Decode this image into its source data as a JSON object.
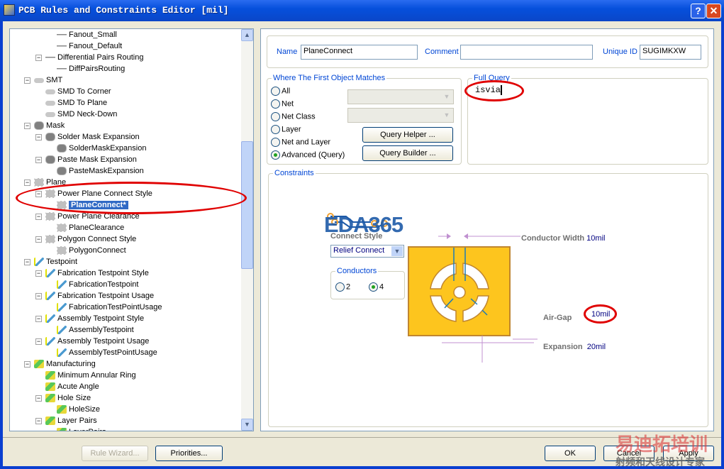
{
  "window": {
    "title": "PCB Rules and Constraints Editor [mil]",
    "help": "?",
    "close": "✕"
  },
  "tree": {
    "items": [
      {
        "label": "Fanout_Small",
        "level": 2,
        "icon": "route",
        "exp": false
      },
      {
        "label": "Fanout_Default",
        "level": 2,
        "icon": "route",
        "exp": false
      },
      {
        "label": "Differential Pairs Routing",
        "level": 1,
        "icon": "route",
        "exp": true
      },
      {
        "label": "DiffPairsRouting",
        "level": 2,
        "icon": "route",
        "exp": false
      },
      {
        "label": "SMT",
        "level": 0,
        "icon": "smt",
        "exp": true
      },
      {
        "label": "SMD To Corner",
        "level": 1,
        "icon": "smt",
        "exp": false
      },
      {
        "label": "SMD To Plane",
        "level": 1,
        "icon": "smt",
        "exp": false
      },
      {
        "label": "SMD Neck-Down",
        "level": 1,
        "icon": "smt",
        "exp": false
      },
      {
        "label": "Mask",
        "level": 0,
        "icon": "mask",
        "exp": true
      },
      {
        "label": "Solder Mask Expansion",
        "level": 1,
        "icon": "mask",
        "exp": true
      },
      {
        "label": "SolderMaskExpansion",
        "level": 2,
        "icon": "mask",
        "exp": false
      },
      {
        "label": "Paste Mask Expansion",
        "level": 1,
        "icon": "mask",
        "exp": true
      },
      {
        "label": "PasteMaskExpansion",
        "level": 2,
        "icon": "mask",
        "exp": false
      },
      {
        "label": "Plane",
        "level": 0,
        "icon": "plane",
        "exp": true
      },
      {
        "label": "Power Plane Connect Style",
        "level": 1,
        "icon": "plane",
        "exp": true
      },
      {
        "label": "PlaneConnect*",
        "level": 2,
        "icon": "plane",
        "exp": false,
        "selected": true
      },
      {
        "label": "Power Plane Clearance",
        "level": 1,
        "icon": "plane",
        "exp": true
      },
      {
        "label": "PlaneClearance",
        "level": 2,
        "icon": "plane",
        "exp": false
      },
      {
        "label": "Polygon Connect Style",
        "level": 1,
        "icon": "plane",
        "exp": true
      },
      {
        "label": "PolygonConnect",
        "level": 2,
        "icon": "plane",
        "exp": false
      },
      {
        "label": "Testpoint",
        "level": 0,
        "icon": "test",
        "exp": true
      },
      {
        "label": "Fabrication Testpoint Style",
        "level": 1,
        "icon": "test",
        "exp": true
      },
      {
        "label": "FabricationTestpoint",
        "level": 2,
        "icon": "test",
        "exp": false
      },
      {
        "label": "Fabrication Testpoint Usage",
        "level": 1,
        "icon": "test",
        "exp": true
      },
      {
        "label": "FabricationTestPointUsage",
        "level": 2,
        "icon": "test",
        "exp": false
      },
      {
        "label": "Assembly Testpoint Style",
        "level": 1,
        "icon": "test",
        "exp": true
      },
      {
        "label": "AssemblyTestpoint",
        "level": 2,
        "icon": "test",
        "exp": false
      },
      {
        "label": "Assembly Testpoint Usage",
        "level": 1,
        "icon": "test",
        "exp": true
      },
      {
        "label": "AssemblyTestPointUsage",
        "level": 2,
        "icon": "test",
        "exp": false
      },
      {
        "label": "Manufacturing",
        "level": 0,
        "icon": "mfg",
        "exp": true
      },
      {
        "label": "Minimum Annular Ring",
        "level": 1,
        "icon": "mfg",
        "exp": false
      },
      {
        "label": "Acute Angle",
        "level": 1,
        "icon": "mfg",
        "exp": false
      },
      {
        "label": "Hole Size",
        "level": 1,
        "icon": "mfg",
        "exp": true
      },
      {
        "label": "HoleSize",
        "level": 2,
        "icon": "mfg",
        "exp": false
      },
      {
        "label": "Layer Pairs",
        "level": 1,
        "icon": "mfg",
        "exp": true
      },
      {
        "label": "LayerPairs",
        "level": 2,
        "icon": "mfg",
        "exp": false
      }
    ]
  },
  "rule": {
    "name_label": "Name",
    "name": "PlaneConnect",
    "comment_label": "Comment",
    "comment": "",
    "uid_label": "Unique ID",
    "uid": "SUGIMKXW"
  },
  "match": {
    "title": "Where The First Object Matches",
    "options": [
      "All",
      "Net",
      "Net Class",
      "Layer",
      "Net and Layer",
      "Advanced (Query)"
    ],
    "selected": 5,
    "query_helper": "Query Helper ...",
    "query_builder": "Query Builder ..."
  },
  "query": {
    "title": "Full Query",
    "text": "isvia"
  },
  "constraints": {
    "title": "Constraints",
    "connect_style_label": "Connect Style",
    "connect_style": "Relief Connect",
    "conductors_label": "Conductors",
    "conductor_options": [
      "2",
      "4"
    ],
    "conductors_selected": 1,
    "conductor_width_label": "Conductor Width",
    "conductor_width": "10mil",
    "air_gap_label": "Air-Gap",
    "air_gap": "10mil",
    "expansion_label": "Expansion",
    "expansion": "20mil"
  },
  "buttons": {
    "rule_wizard": "Rule Wizard...",
    "priorities": "Priorities...",
    "ok": "OK",
    "cancel": "Cancel",
    "apply": "Apply"
  },
  "watermark": {
    "logo": "EDA365",
    "cn_title": "易迪拓培训",
    "cn_sub": "射频和天线设计专家"
  }
}
